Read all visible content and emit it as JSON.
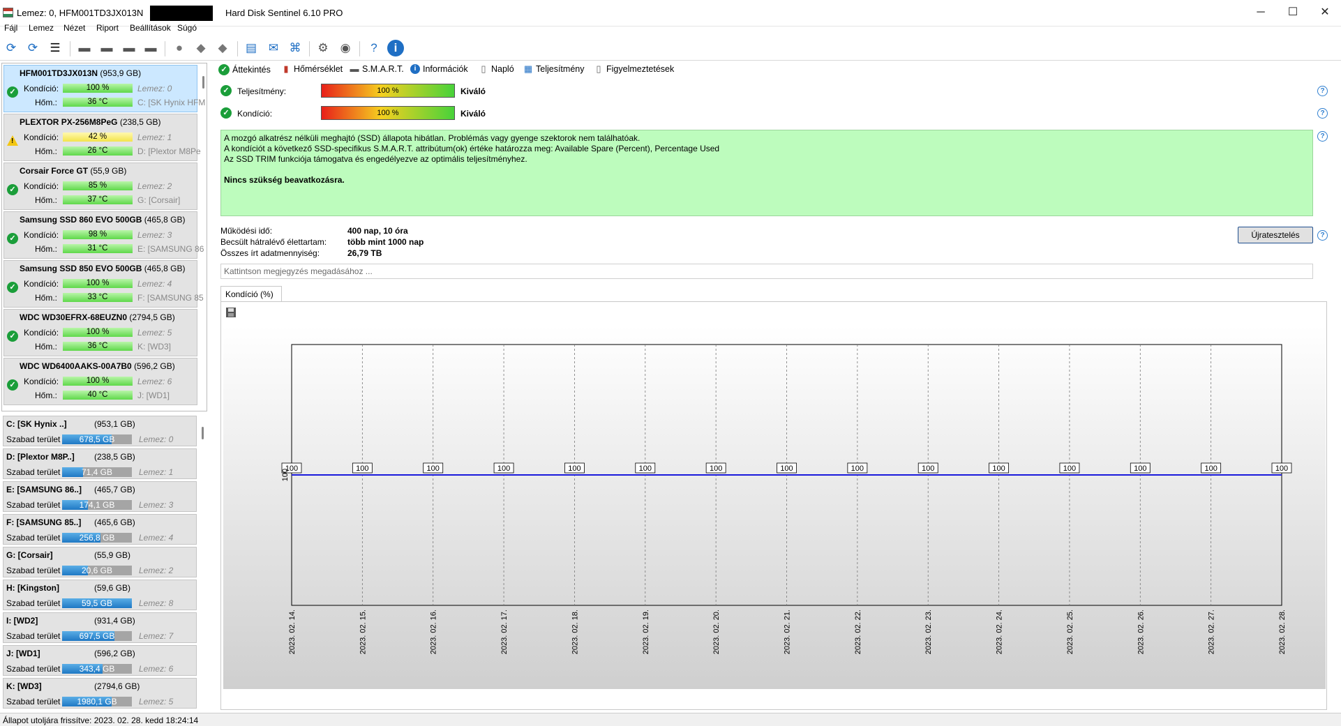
{
  "window": {
    "title_left": "Lemez: 0, HFM001TD3JX013N",
    "title_center": "Hard Disk Sentinel 6.10 PRO",
    "min": "─",
    "max": "☐",
    "close": "✕"
  },
  "menu": [
    {
      "label": "Fájl"
    },
    {
      "label": "Lemez"
    },
    {
      "label": "Nézet"
    },
    {
      "label": "Riport"
    },
    {
      "label": "Beállítások"
    },
    {
      "label": "Súgó"
    }
  ],
  "toolbar_icons": [
    "refresh-icon",
    "refresh-warning-icon",
    "disk-list-icon",
    "disk-icon",
    "disk-time-icon",
    "disk-check-icon",
    "disk-search-icon",
    "hdd-icon",
    "hdd-tools-icon",
    "hdd-alert-icon",
    "report-icon",
    "email-icon",
    "network-icon",
    "settings-icon",
    "sound-icon",
    "help-icon",
    "info-icon"
  ],
  "disks": [
    {
      "name": "HFM001TD3JX013N",
      "cap": "(953,9 GB)",
      "cond_label": "Kondíció:",
      "cond": "100 %",
      "temp_label": "Hőm.:",
      "temp": "36 °C",
      "lemez": "Lemez: 0",
      "drive": "C: [SK Hynix HFM",
      "status": "ok",
      "bar": "green"
    },
    {
      "name": "PLEXTOR PX-256M8PeG",
      "cap": "(238,5 GB)",
      "cond_label": "Kondíció:",
      "cond": "42 %",
      "temp_label": "Hőm.:",
      "temp": "26 °C",
      "lemez": "Lemez: 1",
      "drive": "D: [Plextor M8Pe",
      "status": "warn",
      "bar": "yellow"
    },
    {
      "name": "Corsair Force GT",
      "cap": "(55,9 GB)",
      "cond_label": "Kondíció:",
      "cond": "85 %",
      "temp_label": "Hőm.:",
      "temp": "37 °C",
      "lemez": "Lemez: 2",
      "drive": "G: [Corsair]",
      "status": "ok",
      "bar": "green"
    },
    {
      "name": "Samsung SSD 860 EVO 500GB",
      "cap": "(465,8 GB)",
      "cond_label": "Kondíció:",
      "cond": "98 %",
      "temp_label": "Hőm.:",
      "temp": "31 °C",
      "lemez": "Lemez: 3",
      "drive": "E: [SAMSUNG 86",
      "status": "ok",
      "bar": "green"
    },
    {
      "name": "Samsung SSD 850 EVO 500GB",
      "cap": "(465,8 GB)",
      "cond_label": "Kondíció:",
      "cond": "100 %",
      "temp_label": "Hőm.:",
      "temp": "33 °C",
      "lemez": "Lemez: 4",
      "drive": "F: [SAMSUNG 85",
      "status": "ok",
      "bar": "green"
    },
    {
      "name": "WDC WD30EFRX-68EUZN0",
      "cap": "(2794,5 GB)",
      "cond_label": "Kondíció:",
      "cond": "100 %",
      "temp_label": "Hőm.:",
      "temp": "36 °C",
      "lemez": "Lemez: 5",
      "drive": "K: [WD3]",
      "status": "ok",
      "bar": "green"
    },
    {
      "name": "WDC WD6400AAKS-00A7B0",
      "cap": "(596,2 GB)",
      "cond_label": "Kondíció:",
      "cond": "100 %",
      "temp_label": "Hőm.:",
      "temp": "40 °C",
      "lemez": "Lemez: 6",
      "drive": "J: [WD1]",
      "status": "ok",
      "bar": "green"
    }
  ],
  "volumes": [
    {
      "name": "C: [SK Hynix ..]",
      "cap": "(953,1 GB)",
      "free_label": "Szabad terület",
      "free": "678,5 GB",
      "fill": 0.71,
      "lemez": "Lemez: 0"
    },
    {
      "name": "D: [Plextor M8P..]",
      "cap": "(238,5 GB)",
      "free_label": "Szabad terület",
      "free": "71,4 GB",
      "fill": 0.3,
      "lemez": "Lemez: 1"
    },
    {
      "name": "E: [SAMSUNG 86..]",
      "cap": "(465,7 GB)",
      "free_label": "Szabad terület",
      "free": "174,1 GB",
      "fill": 0.37,
      "lemez": "Lemez: 3"
    },
    {
      "name": "F: [SAMSUNG 85..]",
      "cap": "(465,6 GB)",
      "free_label": "Szabad terület",
      "free": "256,8 GB",
      "fill": 0.55,
      "lemez": "Lemez: 4"
    },
    {
      "name": "G: [Corsair]",
      "cap": "(55,9 GB)",
      "free_label": "Szabad terület",
      "free": "20,6 GB",
      "fill": 0.37,
      "lemez": "Lemez: 2"
    },
    {
      "name": "H: [Kingston]",
      "cap": "(59,6 GB)",
      "free_label": "Szabad terület",
      "free": "59,5 GB",
      "fill": 1.0,
      "lemez": "Lemez: 8"
    },
    {
      "name": "I: [WD2]",
      "cap": "(931,4 GB)",
      "free_label": "Szabad terület",
      "free": "697,5 GB",
      "fill": 0.75,
      "lemez": "Lemez: 7"
    },
    {
      "name": "J: [WD1]",
      "cap": "(596,2 GB)",
      "free_label": "Szabad terület",
      "free": "343,4 GB",
      "fill": 0.58,
      "lemez": "Lemez: 6"
    },
    {
      "name": "K: [WD3]",
      "cap": "(2794,6 GB)",
      "free_label": "Szabad terület",
      "free": "1980,1 GB",
      "fill": 0.71,
      "lemez": "Lemez: 5"
    }
  ],
  "tabs": [
    {
      "label": "Áttekintés",
      "icon": "check-icon"
    },
    {
      "label": "Hőmérséklet",
      "icon": "thermometer-icon"
    },
    {
      "label": "S.M.A.R.T.",
      "icon": "disk-icon"
    },
    {
      "label": "Információk",
      "icon": "info-icon"
    },
    {
      "label": "Napló",
      "icon": "document-icon"
    },
    {
      "label": "Teljesítmény",
      "icon": "performance-icon"
    },
    {
      "label": "Figyelmeztetések",
      "icon": "alerts-icon"
    }
  ],
  "overview": {
    "perf_label": "Teljesítmény:",
    "perf_value": "100 %",
    "perf_text": "Kiváló",
    "cond_label": "Kondíció:",
    "cond_value": "100 %",
    "cond_text": "Kiváló",
    "info_lines": [
      "A mozgó alkatrész nélküli meghajtó (SSD) állapota hibátlan. Problémás vagy gyenge szektorok nem találhatóak.",
      "A kondíciót a következő SSD-specifikus S.M.A.R.T. attribútum(ok) értéke határozza meg:  Available Spare (Percent), Percentage Used",
      "Az SSD TRIM funkciója támogatva és engedélyezve az optimális teljesítményhez."
    ],
    "info_bold": "Nincs szükség beavatkozásra.",
    "uptime_label": "Működési idő:",
    "uptime": "400 nap, 10 óra",
    "life_label": "Becsült hátralévő élettartam:",
    "life": "több mint 1000 nap",
    "written_label": "Összes írt adatmennyiség:",
    "written": "26,79 TB",
    "retest": "Újratesztelés",
    "note_placeholder": "Kattintson megjegyzés megadásához ...",
    "chart_tab": "Kondíció  (%)"
  },
  "chart_data": {
    "type": "line",
    "x": [
      "2023. 02. 14.",
      "2023. 02. 15.",
      "2023. 02. 16.",
      "2023. 02. 17.",
      "2023. 02. 18.",
      "2023. 02. 19.",
      "2023. 02. 20.",
      "2023. 02. 21.",
      "2023. 02. 22.",
      "2023. 02. 23.",
      "2023. 02. 24.",
      "2023. 02. 25.",
      "2023. 02. 26.",
      "2023. 02. 27.",
      "2023. 02. 28."
    ],
    "series": [
      {
        "values": [
          100,
          100,
          100,
          100,
          100,
          100,
          100,
          100,
          100,
          100,
          100,
          100,
          100,
          100,
          100
        ]
      }
    ],
    "y_tick": "100",
    "line_color": "#1a1adc",
    "grid": true
  },
  "statusbar": "Állapot utoljára frissítve: 2023. 02. 28. kedd 18:24:14"
}
